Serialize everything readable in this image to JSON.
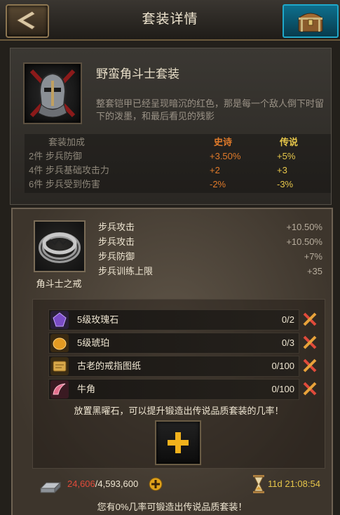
{
  "header": {
    "title": "套装详情"
  },
  "set": {
    "name": "野蛮角斗士套装",
    "description": "整套铠甲已经呈现暗沉的红色，那是每一个敌人倒下时留下的泼墨，和最后看见的残影",
    "bonus_header": {
      "label": "套装加成",
      "epic": "史诗",
      "legendary": "传说"
    },
    "bonus_rows": [
      {
        "label": "2件 步兵防御",
        "epic": "+3.50%",
        "legendary": "+5%"
      },
      {
        "label": "4件 步兵基础攻击力",
        "epic": "+2",
        "legendary": "+3"
      },
      {
        "label": "6件 步兵受到伤害",
        "epic": "-2%",
        "legendary": "-3%"
      }
    ]
  },
  "item": {
    "name": "角斗士之戒",
    "stats": [
      {
        "label": "步兵攻击",
        "value": "+10.50%"
      },
      {
        "label": "步兵攻击",
        "value": "+10.50%"
      },
      {
        "label": "步兵防御",
        "value": "+7%"
      },
      {
        "label": "步兵训练上限",
        "value": "+35"
      }
    ]
  },
  "materials": [
    {
      "name": "5级玫瑰石",
      "count": "0/2",
      "icon": "rose-stone-icon",
      "color": "#6a3fb0"
    },
    {
      "name": "5级琥珀",
      "count": "0/3",
      "icon": "amber-icon",
      "color": "#d9901e"
    },
    {
      "name": "古老的戒指图纸",
      "count": "0/100",
      "icon": "blueprint-icon",
      "color": "#c7922f"
    },
    {
      "name": "牛角",
      "count": "0/100",
      "icon": "horn-icon",
      "color": "#d85a7a"
    }
  ],
  "hint": "放置黑曜石，可以提升锻造出传说品质套装的几率！",
  "resources": {
    "current": "24,606",
    "max": "/4,593,600",
    "timer": "11d 21:08:54"
  },
  "chance_text": "您有0%几率可锻造出传说品质套装！",
  "colors": {
    "epic": "#e07a2a",
    "legendary": "#e7c64a",
    "missing": "#e04a3a",
    "header_accent": "#1fa8c9"
  }
}
